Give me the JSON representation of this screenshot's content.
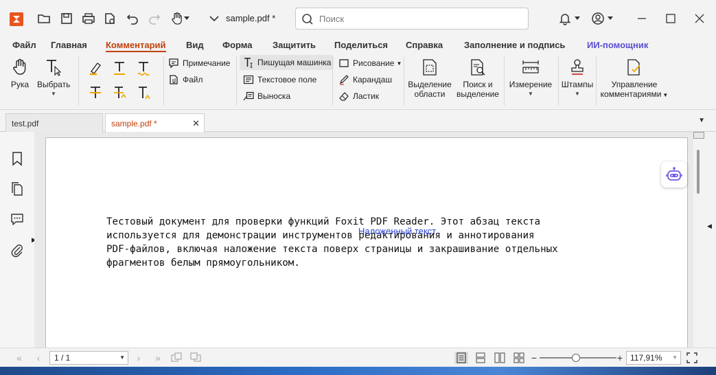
{
  "titlebar": {
    "doc_title": "sample.pdf *",
    "search_placeholder": "Поиск"
  },
  "menu": {
    "tabs": [
      {
        "label": "Файл"
      },
      {
        "label": "Главная"
      },
      {
        "label": "Комментарий",
        "active": true
      },
      {
        "label": "Вид"
      },
      {
        "label": "Форма"
      },
      {
        "label": "Защитить"
      },
      {
        "label": "Поделиться"
      },
      {
        "label": "Справка"
      },
      {
        "label": "Заполнение и подпись"
      },
      {
        "label": "ИИ-помощник"
      }
    ]
  },
  "ribbon": {
    "hand": "Рука",
    "select": "Выбрать",
    "note": "Примечание",
    "file": "Файл",
    "typewriter": "Пишущая машинка",
    "textbox": "Текстовое поле",
    "callout": "Выноска",
    "drawing": "Рисование",
    "pencil": "Карандаш",
    "eraser": "Ластик",
    "area_line1": "Выделение",
    "area_line2": "области",
    "search_line1": "Поиск и",
    "search_line2": "выделение",
    "measure": "Измерение",
    "stamps": "Штампы",
    "manage_line1": "Управление",
    "manage_line2": "комментариями"
  },
  "tabs": [
    {
      "label": "test.pdf",
      "active": false
    },
    {
      "label": "sample.pdf *",
      "active": true
    }
  ],
  "document": {
    "body_text": "Тестовый документ для проверки функций Foxit PDF Reader. Этот абзац текста\nиспользуется для демонстрации инструментов редактирования и аннотирования\nPDF-файлов, включая наложение текста поверх страницы и закрашивание отдельных\nфрагментов белым прямоугольником.",
    "overlay_text": "Наложенный текст"
  },
  "status": {
    "page": "1 / 1",
    "zoom": "117,91%",
    "zoom_level": 0.47
  },
  "colors": {
    "accent": "#c2410c",
    "ai": "#5b4fd1",
    "overlay": "#2a45d1"
  }
}
